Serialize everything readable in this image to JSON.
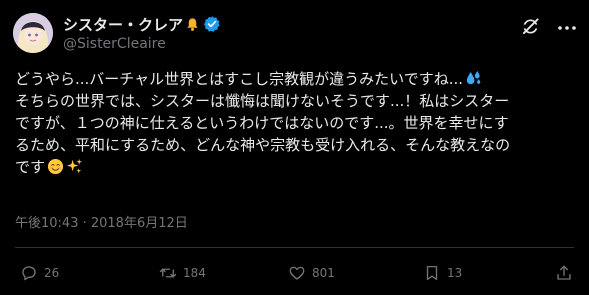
{
  "author": {
    "display_name": "シスター・クレア",
    "handle": "@SisterCleaire"
  },
  "post": {
    "lines": [
      "どうやら...バーチャル世界とはすこし宗教観が違うみたいですね...",
      "そちらの世界では、シスターは懺悔は聞けないそうです...！私はシスター",
      "ですが、１つの神に仕えるというわけではないのです...。世界を幸せにす",
      "るため、平和にするため、どんな神や宗教も受け入れる、そんな教えなの",
      "です"
    ],
    "emoji_line1": "sweat-droplets-emoji",
    "emoji_line5": [
      "smiling-face-emoji",
      "sparkles-emoji"
    ]
  },
  "timestamp": "午後10:43 · 2018年6月12日",
  "actions": {
    "replies": "26",
    "reposts": "184",
    "likes": "801",
    "bookmarks": "13"
  },
  "colors": {
    "background": "#000000",
    "text": "#e7e9ea",
    "muted": "#71767b",
    "verified": "#1d9bf0",
    "divider": "#2f3336"
  }
}
